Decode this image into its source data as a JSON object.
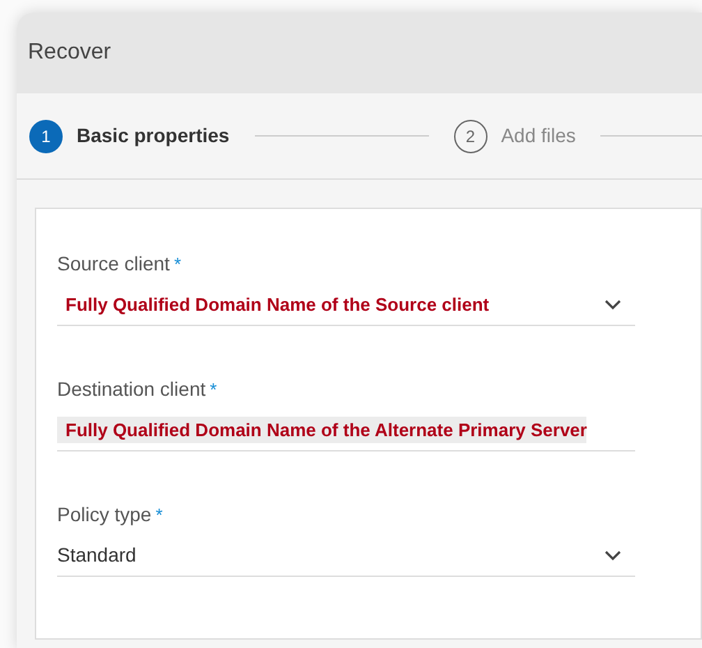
{
  "dialog": {
    "title": "Recover"
  },
  "steps": [
    {
      "number": "1",
      "label": "Basic properties",
      "selected": true
    },
    {
      "number": "2",
      "label": "Add files",
      "selected": false
    }
  ],
  "fields": [
    {
      "kind": "select",
      "label": "Source client",
      "required_mark": "*",
      "value": "Fully Qualified Domain Name of the Source client",
      "annotated": true
    },
    {
      "kind": "text",
      "label": "Destination client",
      "required_mark": "*",
      "value": "Fully Qualified Domain Name of the Alternate Primary Server",
      "annotated": true
    },
    {
      "kind": "select",
      "label": "Policy type",
      "required_mark": "*",
      "value": "Standard",
      "annotated": false
    }
  ]
}
